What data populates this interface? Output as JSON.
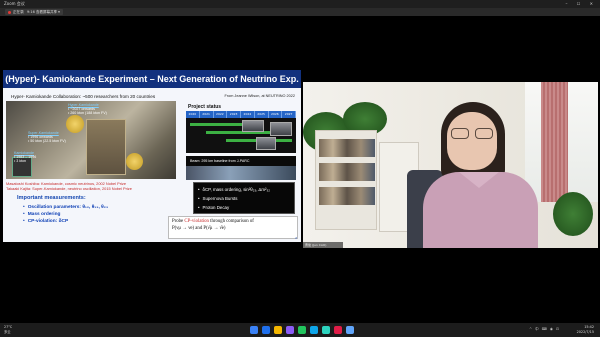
{
  "window": {
    "title": "Zoom 会议",
    "controls": "– ☐ ✕"
  },
  "toolbar": {
    "recording_label": "正在录制",
    "view_label": "9:16 查看屏幕共享 ▾"
  },
  "slide": {
    "title": "(Hyper)- Kamiokande Experiment – Next Generation of Neutrino Exp.",
    "collaboration": "Hyper- Kamiokande Collaboration:  ~500 researchers from 20 countries",
    "source": "From Jeanne Wilson, at NEUTRINO 2022",
    "hyperk": {
      "name": "Hyper-Kamiokande",
      "line1": "• ~2027 onwards",
      "line2": "• 260 kton (188 kton FV)"
    },
    "superk": {
      "name": "Super-Kamiokande",
      "line1": "• 1996 onwards",
      "line2": "• 50 kton (22.5 kton FV)"
    },
    "kamiokande": {
      "name": "Kamiokande",
      "line1": "• 1983 – 1996",
      "line2": "• 3 kton"
    },
    "nobel1": "Masatoshi Koshiba:  Kamiokande, cosmic neutrinos, 2002 Nobel Prize",
    "nobel2": "Takaaki Kajita: Super-Kamiokande, neutrino oscillation, 2015 Nobel Prize",
    "important_heading": "Important measurements:",
    "measurements": [
      "Oscillation parameters: θ₁₂, θ₁₃, θ₂₃",
      "Mass ordering",
      "CP-violation: δCP"
    ],
    "project_status": "Project status",
    "years": [
      "2020",
      "2021",
      "2022",
      "2023",
      "2024",
      "2025",
      "2026",
      "2027"
    ],
    "beam": "Beam: 295 km baseline from J-PARC",
    "physics": [
      "δCP, mass ordering, sin²θ₂₃, Δm²₃₂",
      "Supernova Bursts",
      "Proton Decay"
    ],
    "cp_line1_a": "Probe ",
    "cp_line1_red": "CP-violation",
    "cp_line1_b": " through comparison of",
    "cp_line2": "P(νμ → νe) and P(ν̄μ → ν̄e)",
    "page_number": "2"
  },
  "video": {
    "participant_name": "曹俊 (Jun CAO)"
  },
  "taskbar": {
    "weather_temp": "27°C",
    "weather_desc": "多云",
    "tray": "^ 中 ⌨ ◉ ⊡",
    "time": "15:42",
    "date": "2022/7/15",
    "app_colors": [
      "#3b82f6",
      "#1f6feb",
      "#f5b700",
      "#8b5cf6",
      "#22c55e",
      "#0ea5e9",
      "#2dd4bf",
      "#e11d48",
      "#60a5fa"
    ]
  }
}
